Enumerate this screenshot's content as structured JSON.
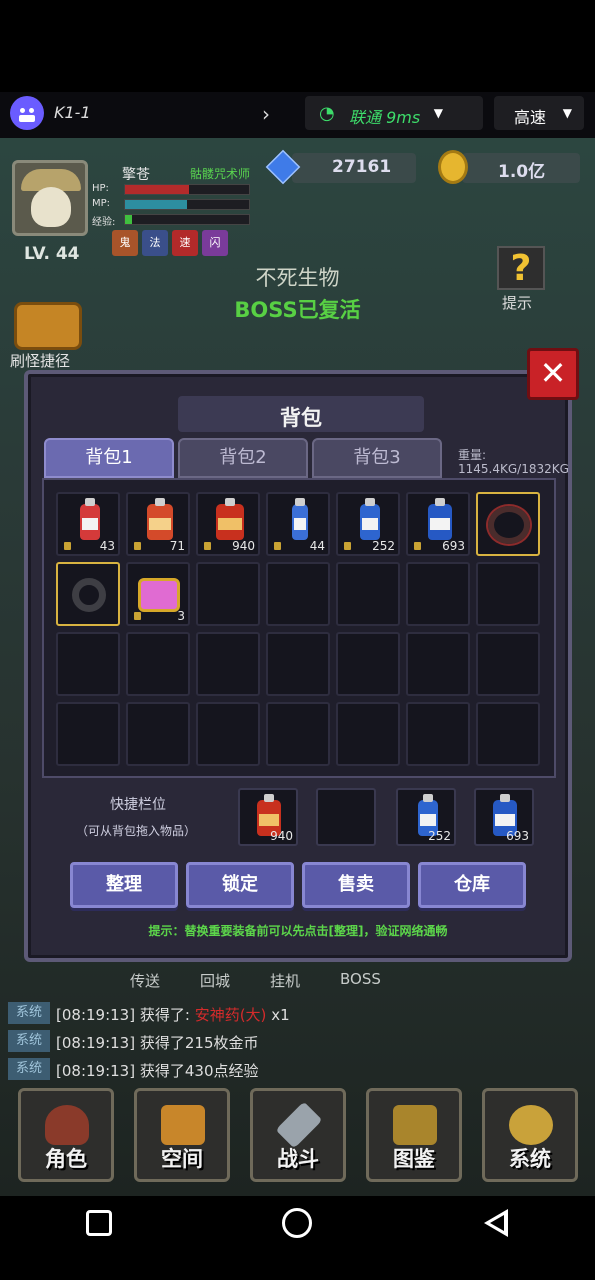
{
  "topbar": {
    "app_title": "K1-1",
    "network_text": "联通 9ms",
    "speed_text": "高速"
  },
  "hud": {
    "player_name": "擎苍",
    "player_class": "骷髅咒术师",
    "level": "LV. 44",
    "hp_label": "HP:",
    "mp_label": "MP:",
    "exp_label": "经验:",
    "hp_fraction": 0.52,
    "mp_fraction": 0.5,
    "exp_fraction": 0.06,
    "gems": "27161",
    "gold": "1.0亿",
    "buffs": [
      "鬼",
      "法",
      "速",
      "闪"
    ],
    "monster_name": "不死生物",
    "boss_status": "BOSS已复活",
    "hint_label": "提示",
    "fast_kill_label": "刷怪捷径"
  },
  "bag": {
    "title": "背包",
    "tabs": [
      "背包1",
      "背包2",
      "背包3"
    ],
    "weight_label": "重量:",
    "weight_value": "1145.4KG/1832KG",
    "items": [
      {
        "icon": "red-potion-icon",
        "count": "43"
      },
      {
        "icon": "red-potion-icon",
        "count": "71"
      },
      {
        "icon": "red-potion-icon",
        "count": "940"
      },
      {
        "icon": "blue-potion-icon",
        "count": "44"
      },
      {
        "icon": "blue-potion-icon",
        "count": "252"
      },
      {
        "icon": "blue-potion-icon",
        "count": "693"
      },
      {
        "icon": "ring-icon",
        "count": ""
      },
      {
        "icon": "ring-icon",
        "count": ""
      },
      {
        "icon": "treasure-chest-icon",
        "count": "3"
      }
    ],
    "quick_label": "快捷栏位",
    "quick_sub": "（可从背包拖入物品）",
    "quick_slots": [
      "940",
      "",
      "252",
      "693"
    ],
    "buttons": [
      "整理",
      "锁定",
      "售卖",
      "仓库"
    ],
    "tip": "提示：替换重要装备前可以先点击[整理]，验证网络通畅"
  },
  "subnav": [
    "传送",
    "回城",
    "挂机",
    "BOSS"
  ],
  "log": [
    {
      "tag": "系统",
      "time": "[08:19:13]",
      "text": "获得了:",
      "highlight": "安神药(大)",
      "suffix": "x1"
    },
    {
      "tag": "系统",
      "time": "[08:19:13]",
      "text": "获得了215枚金币",
      "highlight": "",
      "suffix": ""
    },
    {
      "tag": "系统",
      "time": "[08:19:13]",
      "text": "获得了430点经验",
      "highlight": "",
      "suffix": ""
    }
  ],
  "menu": [
    "角色",
    "空间",
    "战斗",
    "图鉴",
    "系统"
  ],
  "colors": {
    "panel_bg": "#2a2838",
    "tab_active": "#6b6ab0",
    "button": "#5a5aa8",
    "tip_green": "#5cd64a",
    "close_red": "#c92227"
  }
}
